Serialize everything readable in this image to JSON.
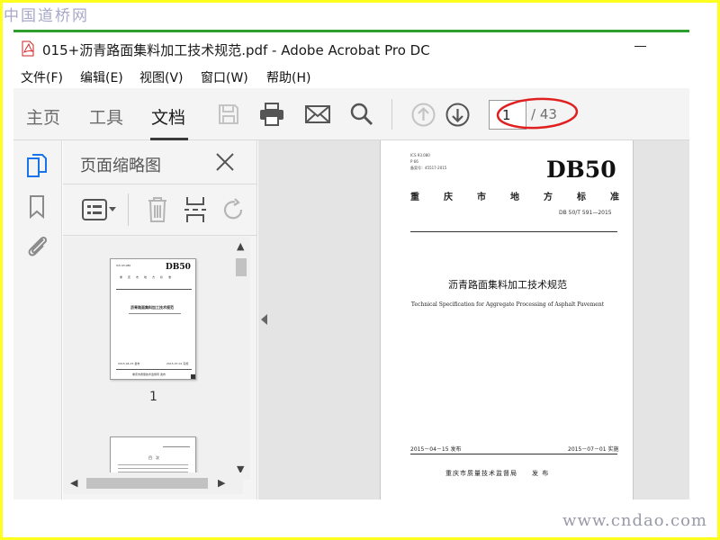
{
  "watermark": {
    "top": "中国道桥网",
    "bottom": "www.cndao.com"
  },
  "window": {
    "title": "015+沥青路面集料加工技术规范.pdf - Adobe Acrobat Pro DC"
  },
  "menu": [
    "文件(F)",
    "编辑(E)",
    "视图(V)",
    "窗口(W)",
    "帮助(H)"
  ],
  "toolbar": {
    "tabs": [
      "主页",
      "工具",
      "文档"
    ],
    "active_tab": "文档",
    "page_current": "1",
    "page_total": "/ 43"
  },
  "panel": {
    "title": "页面缩略图",
    "thumb_labels": [
      "1"
    ]
  },
  "document": {
    "ics": "ICS 93.080",
    "class_code": "P 66",
    "record_no": "备案号：45517-2015",
    "db": "DB50",
    "region_chars": [
      "重",
      "庆",
      "市",
      "地",
      "方",
      "标",
      "准"
    ],
    "std_no": "DB 50/T 591—2015",
    "title": "沥青路面集料加工技术规范",
    "subtitle": "Technical Specification for Aggregate Processing of Asphalt Pavement",
    "issue_date": "2015－04－15 发布",
    "impl_date": "2015－07－01 实施",
    "issuer": "重庆市质量技术监督局　　发 布"
  },
  "colors": {
    "accent": "#1a73e8",
    "red_mark": "#e02020",
    "yellow_border": "#ffff1e",
    "green_line": "#2c9f2c"
  }
}
